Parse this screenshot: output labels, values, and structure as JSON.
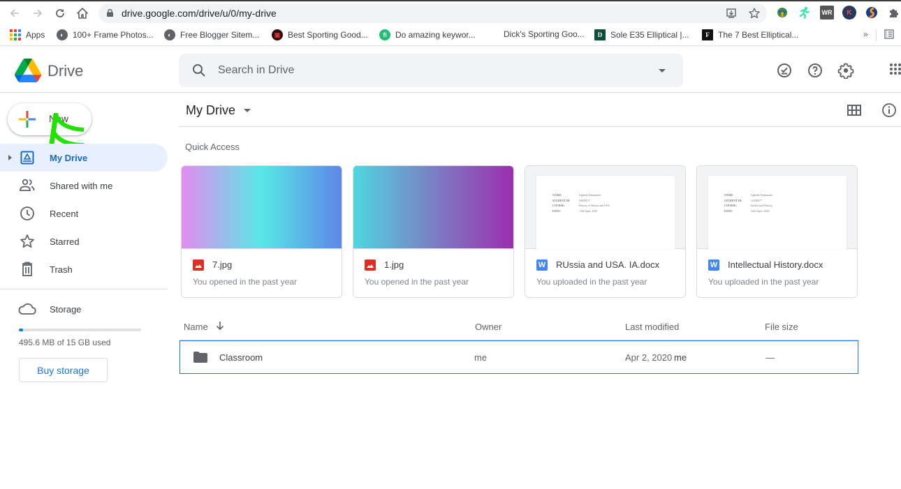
{
  "browser": {
    "url": "drive.google.com/drive/u/0/my-drive",
    "bookmarks": [
      {
        "label": "Apps",
        "icon": "apps-grid-icon"
      },
      {
        "label": "100+ Frame Photos...",
        "icon": "globe-icon"
      },
      {
        "label": "Free Blogger Sitem...",
        "icon": "globe-icon"
      },
      {
        "label": "Best Sporting Good...",
        "icon": "sporting-goods-icon"
      },
      {
        "label": "Do amazing keywor...",
        "icon": "fiverr-icon"
      },
      {
        "label": "Dick's Sporting Goo...",
        "icon": "none"
      },
      {
        "label": "Sole E35 Elliptical |...",
        "icon": "d-logo-icon"
      },
      {
        "label": "The 7 Best Elliptical...",
        "icon": "f-logo-icon"
      }
    ],
    "overflow_label": "»",
    "extensions": [
      "idm-icon",
      "runner-extension-icon",
      "wr-extension-icon",
      "k-extension-icon",
      "s-extension-icon",
      "puzzle-icon"
    ]
  },
  "header": {
    "app_name": "Drive",
    "search_placeholder": "Search in Drive",
    "icons": [
      "offline-ready-icon",
      "help-icon",
      "settings-icon",
      "apps-icon"
    ]
  },
  "sidebar": {
    "new_label": "New",
    "items": [
      {
        "label": "My Drive",
        "icon": "my-drive-icon",
        "active": true
      },
      {
        "label": "Shared with me",
        "icon": "shared-icon"
      },
      {
        "label": "Recent",
        "icon": "clock-icon"
      },
      {
        "label": "Starred",
        "icon": "star-icon"
      },
      {
        "label": "Trash",
        "icon": "trash-icon"
      }
    ],
    "storage": {
      "label": "Storage",
      "used_fraction": 0.032,
      "text": "495.6 MB of 15 GB used",
      "buy_label": "Buy storage"
    }
  },
  "main": {
    "title": "My Drive",
    "quick_access_label": "Quick Access",
    "quick_access": [
      {
        "name": "7.jpg",
        "type": "image",
        "subtitle": "You opened in the past year",
        "gradient": [
          "#e38cf0",
          "#57e8e6",
          "#5e86e8"
        ]
      },
      {
        "name": "1.jpg",
        "type": "image",
        "subtitle": "You opened in the past year",
        "gradient": [
          "#4fd6e0",
          "#7b7fc4",
          "#9c2fae"
        ]
      },
      {
        "name": "RUssia and USA. IA.docx",
        "type": "word",
        "subtitle": "You uploaded in the past year",
        "preview": [
          [
            "NAME:",
            "Agbede Emmanuel"
          ],
          [
            "STUDENT ID:",
            "83658577"
          ],
          [
            "COURSE:",
            "History of Russia and USA"
          ],
          [
            "DATE:",
            "17th April, 2020"
          ]
        ]
      },
      {
        "name": "Intellectual History.docx",
        "type": "word",
        "subtitle": "You uploaded in the past year",
        "preview": [
          [
            "NAME:",
            "Agbede Emmanuel"
          ],
          [
            "STUDENT ID:",
            "11658577"
          ],
          [
            "COURSE:",
            "Intellectual History"
          ],
          [
            "DATE:",
            "23rd April, 2020"
          ]
        ]
      }
    ],
    "columns": {
      "name": "Name",
      "owner": "Owner",
      "modified": "Last modified",
      "size": "File size"
    },
    "files": [
      {
        "name": "Classroom",
        "type": "folder",
        "owner": "me",
        "modified": "Apr 2, 2020",
        "modified_by": "me",
        "size": "—"
      }
    ]
  },
  "colors": {
    "accent": "#1a73e8",
    "active_bg": "#e8f0fe",
    "image_icon": "#d93025",
    "word_icon": "#4285f4",
    "annotation": "#22e000"
  }
}
